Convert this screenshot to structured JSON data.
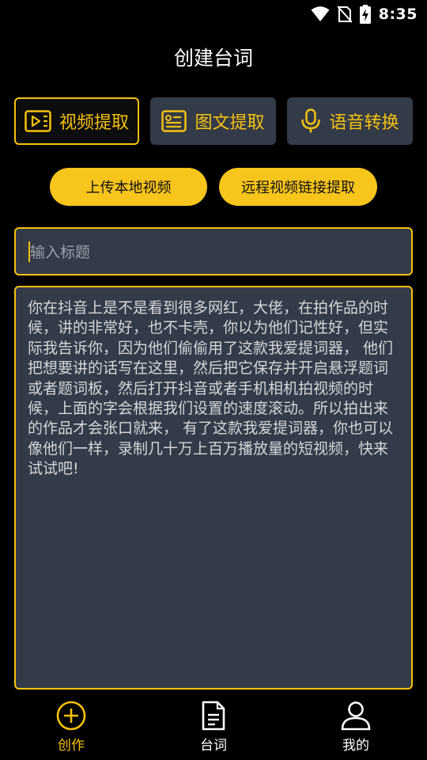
{
  "status": {
    "time": "8:35"
  },
  "header": {
    "title": "创建台词"
  },
  "tabs": [
    {
      "label": "视频提取",
      "icon": "video-play-icon",
      "active": true
    },
    {
      "label": "图文提取",
      "icon": "image-text-icon",
      "active": false
    },
    {
      "label": "语音转换",
      "icon": "microphone-icon",
      "active": false
    }
  ],
  "actions": {
    "upload_label": "上传本地视频",
    "remote_label": "远程视频链接提取"
  },
  "title_input": {
    "placeholder": "输入标题"
  },
  "content": {
    "text": "你在抖音上是不是看到很多网红，大佬，在拍作品的时候，讲的非常好，也不卡壳，你以为他们记性好，但实际我告诉你，因为他们偷偷用了这款我爱提词器， 他们把想要讲的话写在这里，然后把它保存并开启悬浮题词或者题词板，然后打开抖音或者手机相机拍视频的时候，上面的字会根据我们设置的速度滚动。所以拍出来的作品才会张口就来， 有了这款我爱提词器，你也可以像他们一样，录制几十万上百万播放量的短视频，快来试试吧!"
  },
  "bottom_nav": [
    {
      "label": "创作",
      "icon": "plus-circle-icon",
      "active": true
    },
    {
      "label": "台词",
      "icon": "document-icon",
      "active": false
    },
    {
      "label": "我的",
      "icon": "user-icon",
      "active": false
    }
  ],
  "colors": {
    "accent": "#f6c10e",
    "panel": "#333b49",
    "background": "#000000"
  }
}
